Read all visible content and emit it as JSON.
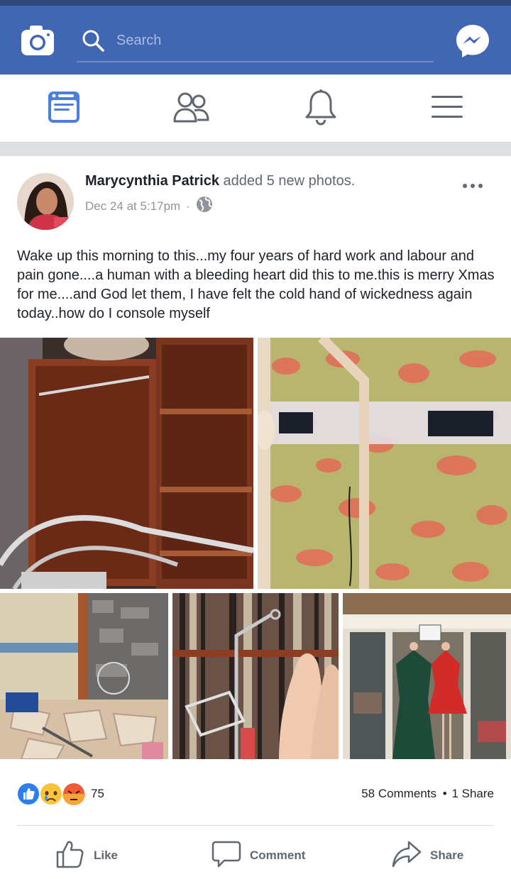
{
  "topbar": {
    "search_placeholder": "Search"
  },
  "navbar": {
    "tabs": [
      {
        "name": "news-feed",
        "icon": "news-feed-icon",
        "active": true
      },
      {
        "name": "friend-requests",
        "icon": "friends-icon",
        "active": false
      },
      {
        "name": "notifications",
        "icon": "bell-icon",
        "active": false
      },
      {
        "name": "menu",
        "icon": "hamburger-menu-icon",
        "active": false
      }
    ]
  },
  "post": {
    "author": "Marycynthia Patrick",
    "action": "added 5 new photos.",
    "timestamp": "Dec 24 at 5:17pm",
    "separator": "·",
    "privacy_icon": "globe-icon",
    "text": "Wake up this morning to this...my four years of hard work and labour and pain gone....a human with a bleeding heart did this to me.this is merry Xmas for me....and God let them, I have felt the cold hand of wickedness again today..how do I console myself",
    "reactions": {
      "icons": [
        "like-reaction-icon",
        "sad-reaction-icon",
        "angry-reaction-icon"
      ],
      "count": "75"
    },
    "comments_label": "58 Comments",
    "dot": "•",
    "shares_label": "1 Share"
  },
  "actions": {
    "like": "Like",
    "comment": "Comment",
    "share": "Share"
  },
  "colors": {
    "brand_blue": "#4267b2",
    "status_bar": "#2f4678",
    "active_tab": "#4a7fe0",
    "inactive_icon": "#606770"
  }
}
